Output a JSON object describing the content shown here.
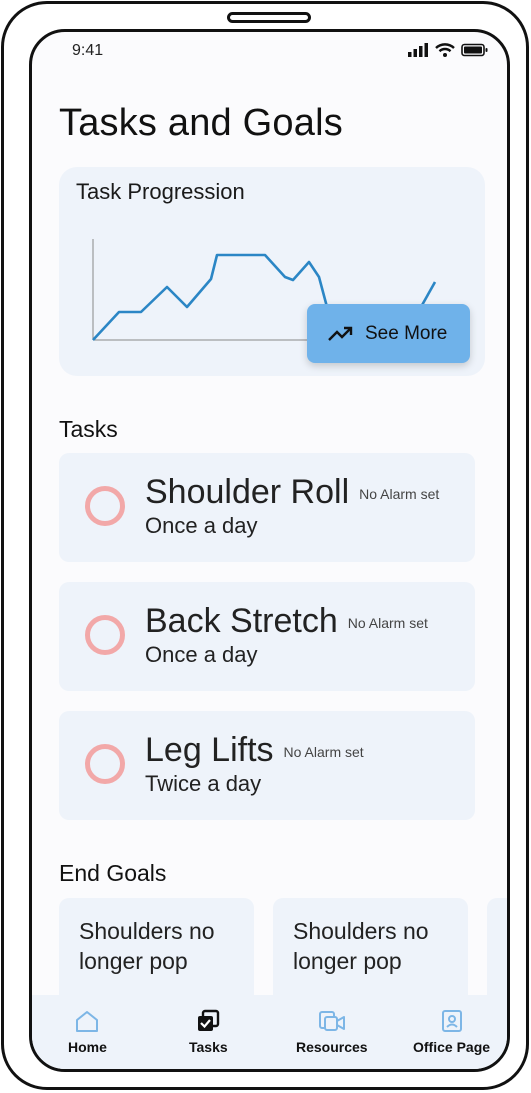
{
  "status": {
    "time": "9:41"
  },
  "page": {
    "title": "Tasks and Goals"
  },
  "progress_card": {
    "title": "Task Progression",
    "see_more_label": "See More"
  },
  "tasks_section": {
    "title": "Tasks"
  },
  "tasks": [
    {
      "name": "Shoulder Roll",
      "alarm": "No Alarm set",
      "frequency": "Once a day"
    },
    {
      "name": "Back Stretch",
      "alarm": "No Alarm set",
      "frequency": "Once a day"
    },
    {
      "name": "Leg Lifts",
      "alarm": "No Alarm set",
      "frequency": "Twice a day"
    }
  ],
  "goals_section": {
    "title": "End Goals"
  },
  "goals": [
    {
      "text": "Shoulders no longer pop"
    },
    {
      "text": "Shoulders no longer pop"
    }
  ],
  "tabbar": {
    "items": [
      {
        "label": "Home",
        "icon": "home-icon"
      },
      {
        "label": "Tasks",
        "icon": "tasks-icon"
      },
      {
        "label": "Resources",
        "icon": "resources-icon"
      },
      {
        "label": "Office Page",
        "icon": "office-page-icon"
      }
    ]
  },
  "colors": {
    "accent": "#6fb2ea",
    "card_bg": "#eef3fa",
    "line": "#2b86c5",
    "ring": "#f2a8a8",
    "tab_inactive": "#7db6e6"
  }
}
